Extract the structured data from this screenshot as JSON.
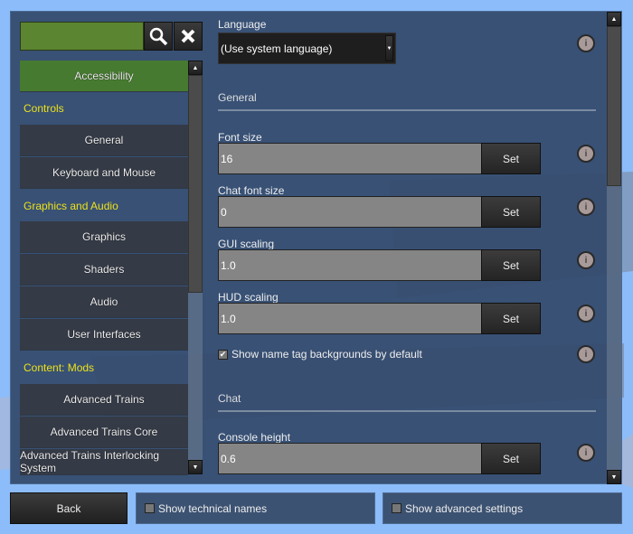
{
  "colors": {
    "accent_active": "#467a30",
    "section_heading": "#ede11a",
    "search_bg": "#5b8530"
  },
  "search": {
    "value": "",
    "search_icon": "search-icon",
    "clear_icon": "close-icon"
  },
  "nav": [
    {
      "type": "item",
      "label": "Accessibility",
      "active": true
    },
    {
      "type": "heading",
      "label": "Controls"
    },
    {
      "type": "item",
      "label": "General"
    },
    {
      "type": "item",
      "label": "Keyboard and Mouse"
    },
    {
      "type": "heading",
      "label": "Graphics and Audio"
    },
    {
      "type": "item",
      "label": "Graphics"
    },
    {
      "type": "item",
      "label": "Shaders"
    },
    {
      "type": "item",
      "label": "Audio"
    },
    {
      "type": "item",
      "label": "User Interfaces"
    },
    {
      "type": "heading",
      "label": "Content: Mods"
    },
    {
      "type": "item",
      "label": "Advanced Trains"
    },
    {
      "type": "item",
      "label": "Advanced Trains Core"
    },
    {
      "type": "item",
      "label": "Advanced Trains Interlocking System"
    }
  ],
  "settings": {
    "language": {
      "label": "Language",
      "value": "(Use system language)"
    },
    "general_heading": "General",
    "font_size": {
      "label": "Font size",
      "value": "16",
      "button": "Set"
    },
    "chat_font_size": {
      "label": "Chat font size",
      "value": "0",
      "button": "Set"
    },
    "gui_scaling": {
      "label": "GUI scaling",
      "value": "1.0",
      "button": "Set"
    },
    "hud_scaling": {
      "label": "HUD scaling",
      "value": "1.0",
      "button": "Set"
    },
    "name_tag": {
      "label": "Show name tag backgrounds by default",
      "checked": true
    },
    "chat_heading": "Chat",
    "console_height": {
      "label": "Console height",
      "value": "0.6",
      "button": "Set"
    }
  },
  "footer": {
    "back": "Back",
    "technical_names": "Show technical names",
    "advanced_settings": "Show advanced settings"
  }
}
